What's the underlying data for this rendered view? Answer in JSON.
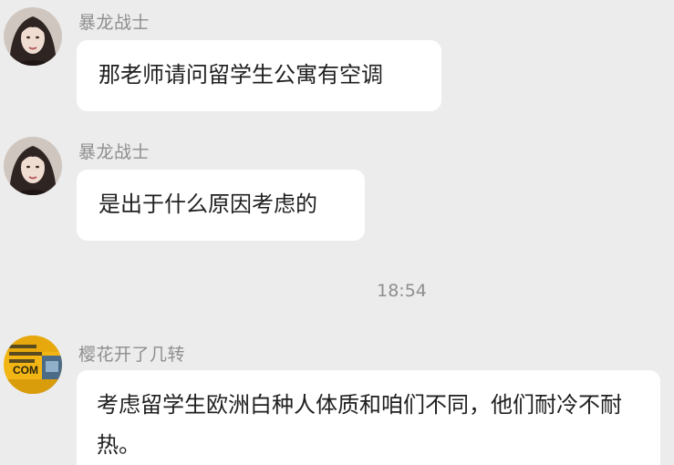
{
  "timestamp": "18:54",
  "messages": [
    {
      "sender": "暴龙战士",
      "avatar": "woman-portrait-avatar",
      "text": "那老师请问留学生公寓有空调"
    },
    {
      "sender": "暴龙战士",
      "avatar": "woman-portrait-avatar",
      "text": "是出于什么原因考虑的"
    },
    {
      "sender": "樱花开了几转",
      "avatar": "yellow-sign-avatar",
      "text": "考虑留学生欧洲白种人体质和咱们不同，他们耐冷不耐热。"
    }
  ],
  "avatar_text": "COM",
  "colors": {
    "background": "#ececec",
    "bubble": "#ffffff",
    "sender_name": "#8e8e8e",
    "message_text": "#1f1f1f",
    "avatar_yellow": "#f2b514"
  }
}
